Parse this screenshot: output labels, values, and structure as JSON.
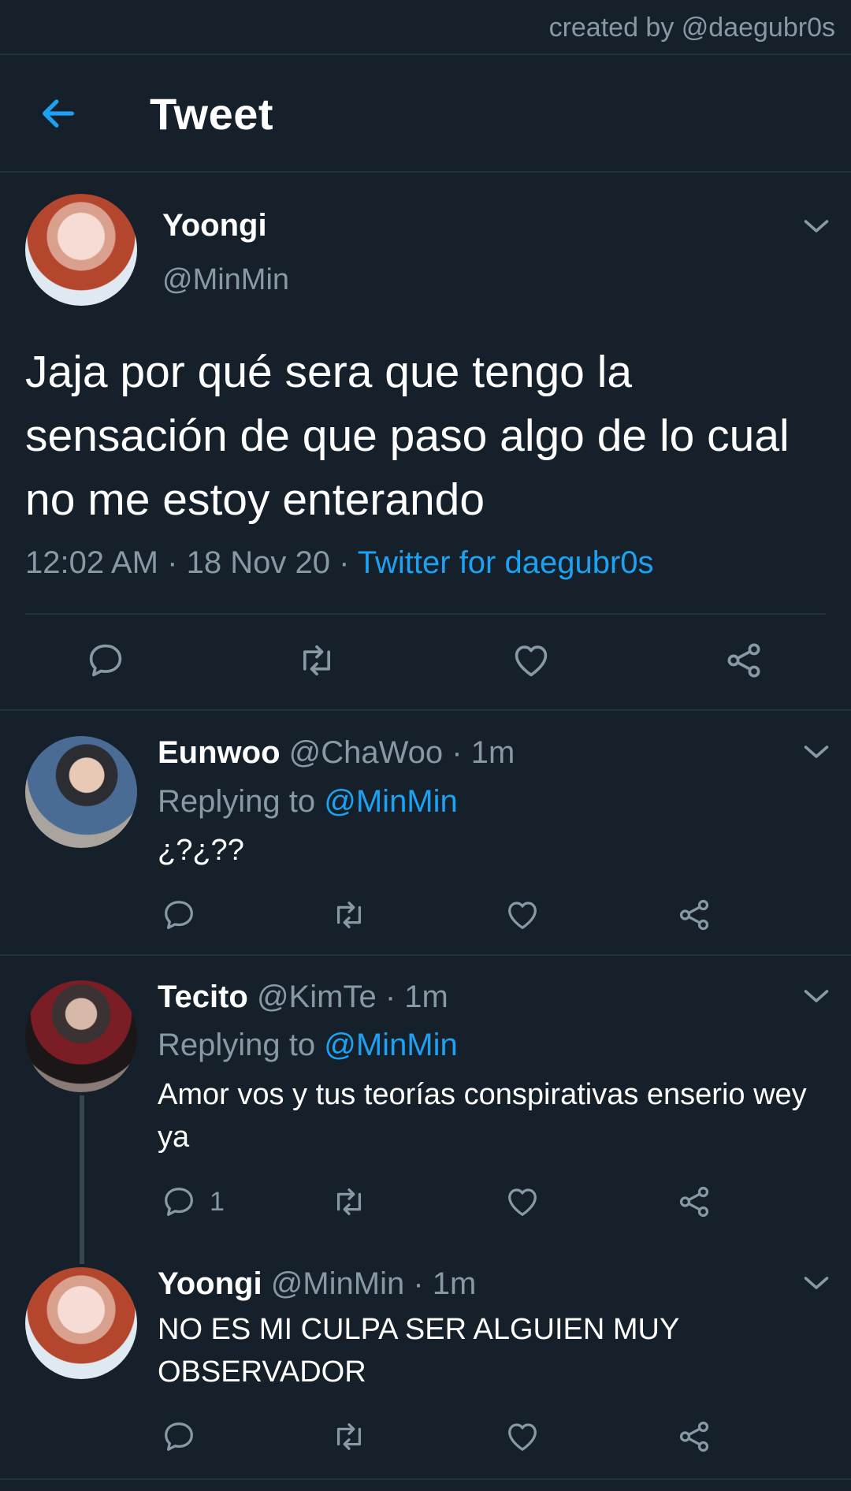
{
  "watermark": "created by @daegubr0s",
  "header": {
    "title": "Tweet",
    "back_icon": "arrow-left-icon"
  },
  "main_tweet": {
    "name": "Yoongi",
    "handle": "@MinMin",
    "text": "Jaja por qué sera que tengo la sensación de que paso algo de lo cual no me estoy enterando",
    "time": "12:02 AM",
    "date": "18 Nov 20",
    "sep": "·",
    "source": "Twitter for daegubr0s",
    "actions": [
      "reply-icon",
      "retweet-icon",
      "like-icon",
      "share-icon"
    ]
  },
  "replies": [
    {
      "name": "Eunwoo",
      "handle": "@ChaWoo",
      "time": "· 1m",
      "replying_prefix": "Replying to",
      "replying_to": "@MinMin",
      "text": "¿?¿??",
      "reply_count": ""
    },
    {
      "name": "Tecito",
      "handle": "@KimTe",
      "time": "· 1m",
      "replying_prefix": "Replying to",
      "replying_to": "@MinMin",
      "text": "Amor vos y tus teorías conspirativas enserio wey ya",
      "reply_count": "1"
    },
    {
      "name": "Yoongi",
      "handle": "@MinMin",
      "time": "· 1m",
      "text": "NO ES MI CULPA SER ALGUIEN MUY OBSERVADOR",
      "reply_count": ""
    }
  ],
  "colors": {
    "background": "#15202b",
    "text": "#ffffff",
    "muted": "#8899a6",
    "accent": "#1da1f2",
    "divider": "#253341"
  }
}
